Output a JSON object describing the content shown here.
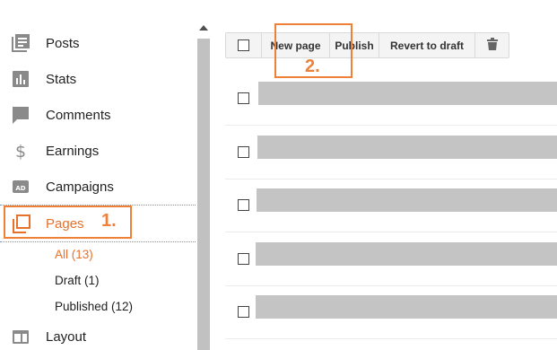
{
  "sidebar": {
    "items": [
      {
        "label": "Posts",
        "icon": "posts-icon"
      },
      {
        "label": "Stats",
        "icon": "stats-icon"
      },
      {
        "label": "Comments",
        "icon": "comments-icon"
      },
      {
        "label": "Earnings",
        "icon": "dollar-icon"
      },
      {
        "label": "Campaigns",
        "icon": "ad-icon"
      },
      {
        "label": "Pages",
        "icon": "pages-icon",
        "active": true
      },
      {
        "label": "Layout",
        "icon": "layout-icon"
      }
    ],
    "pages_submenu": [
      {
        "label": "All (13)",
        "active": true
      },
      {
        "label": "Draft (1)"
      },
      {
        "label": "Published (12)"
      }
    ]
  },
  "annotations": {
    "step1": "1.",
    "step2": "2."
  },
  "toolbar": {
    "new_page": "New page",
    "publish": "Publish",
    "revert": "Revert to draft",
    "delete_icon": "trash-icon"
  },
  "colors": {
    "accent": "#e8702a",
    "annotation": "#ee8038",
    "icon_gray": "#8a8a8a",
    "placeholder_gray": "#c4c4c4"
  }
}
